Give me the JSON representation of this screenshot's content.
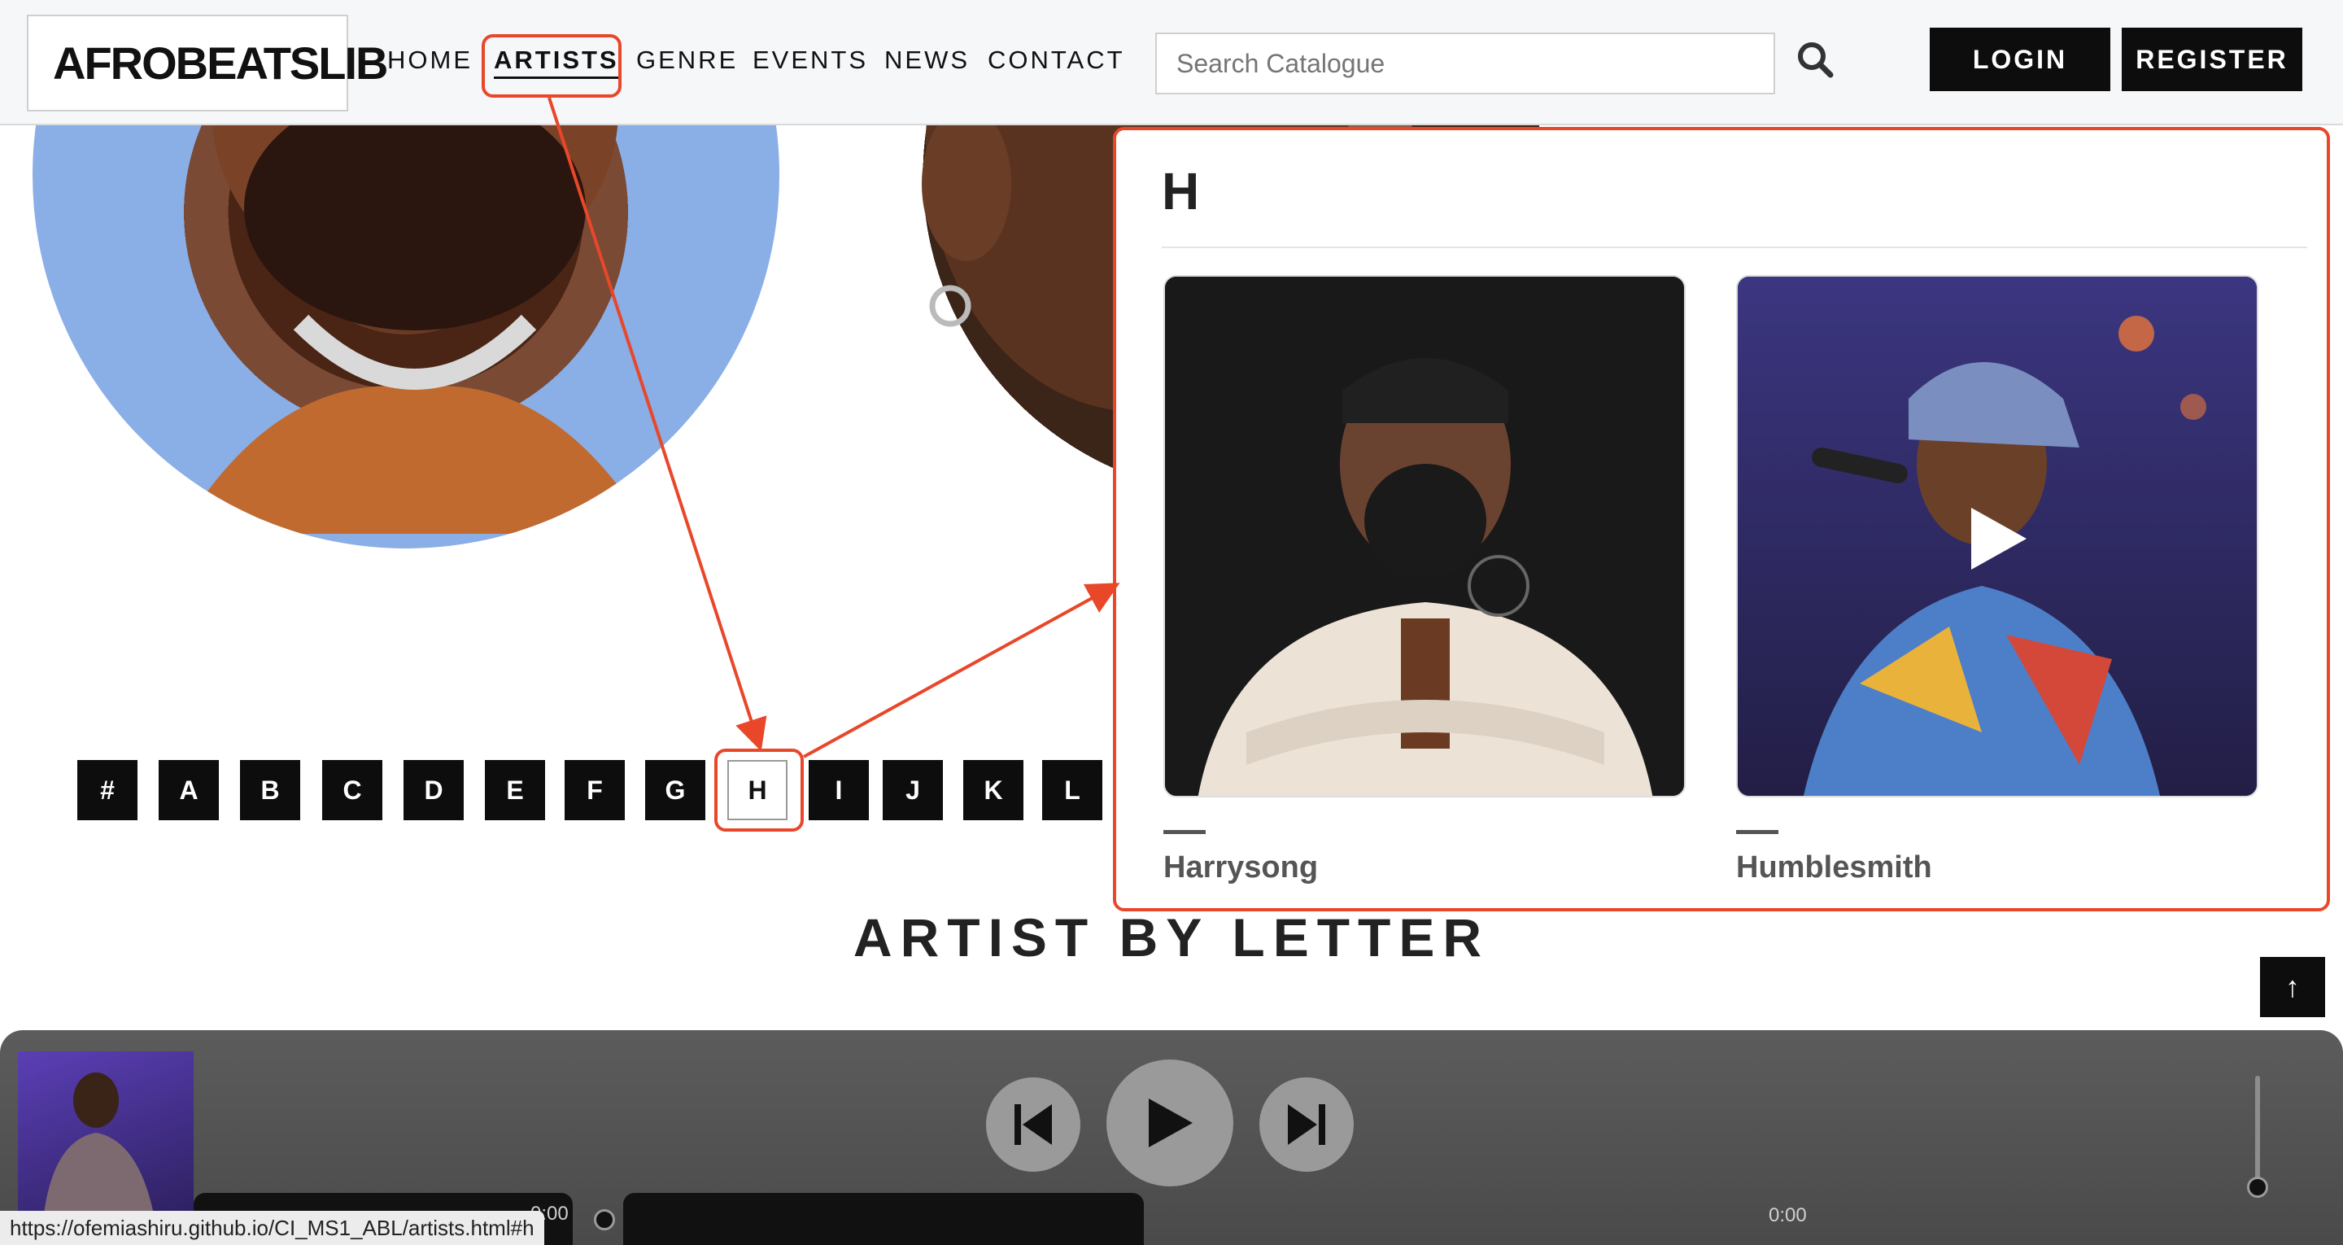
{
  "header": {
    "logo_text": "AFROBEATSLIB",
    "nav": [
      "HOME",
      "ARTISTS",
      "GENRE",
      "EVENTS",
      "NEWS",
      "CONTACT"
    ],
    "active_nav": "ARTISTS",
    "search_placeholder": "Search Catalogue",
    "login_label": "LOGIN",
    "register_label": "REGISTER"
  },
  "alphabet": {
    "letters": [
      "#",
      "A",
      "B",
      "C",
      "D",
      "E",
      "F",
      "G",
      "H",
      "I",
      "J",
      "K",
      "L"
    ],
    "active": "H"
  },
  "popup": {
    "letter": "H",
    "artists": [
      {
        "name": "Harrysong"
      },
      {
        "name": "Humblesmith"
      }
    ]
  },
  "section_title": "ARTIST BY LETTER",
  "to_top_label": "↑",
  "player": {
    "current_time": "0:00",
    "duration": "0:00"
  },
  "status_url": "https://ofemiashiru.github.io/CI_MS1_ABL/artists.html#h",
  "colors": {
    "annotation": "#e8472a",
    "dark": "#0d0d0d",
    "player_bg": "#555555"
  }
}
